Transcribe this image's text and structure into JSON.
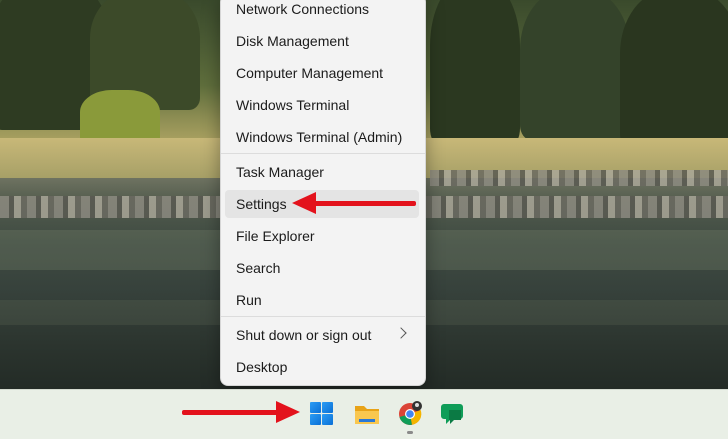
{
  "menu": {
    "items": [
      {
        "label": "Network Connections"
      },
      {
        "label": "Disk Management"
      },
      {
        "label": "Computer Management"
      },
      {
        "label": "Windows Terminal"
      },
      {
        "label": "Windows Terminal (Admin)"
      },
      {
        "label": "Task Manager"
      },
      {
        "label": "Settings"
      },
      {
        "label": "File Explorer"
      },
      {
        "label": "Search"
      },
      {
        "label": "Run"
      },
      {
        "label": "Shut down or sign out"
      },
      {
        "label": "Desktop"
      }
    ],
    "highlighted": "Settings"
  },
  "taskbar": {
    "icons": [
      "windows-start-icon",
      "file-explorer-icon",
      "chrome-icon",
      "google-chat-icon"
    ]
  },
  "colors": {
    "annotation_arrow": "#e3121c",
    "menu_background": "#f3f3f3",
    "windows_blue": "#0a6fd6"
  }
}
